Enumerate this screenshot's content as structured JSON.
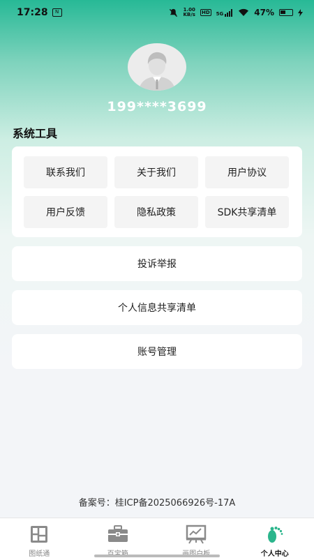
{
  "status_bar": {
    "time": "17:28",
    "app_badge": "N",
    "speed_value": "1.00",
    "speed_unit": "KB/s",
    "hd": "HD",
    "signal": "5G",
    "battery": "47%"
  },
  "profile": {
    "phone": "199****3699"
  },
  "tools": {
    "title": "系统工具",
    "items": [
      {
        "label": "联系我们"
      },
      {
        "label": "关于我们"
      },
      {
        "label": "用户协议"
      },
      {
        "label": "用户反馈"
      },
      {
        "label": "隐私政策"
      },
      {
        "label": "SDK共享清单"
      }
    ]
  },
  "rows": [
    {
      "label": "投诉举报"
    },
    {
      "label": "个人信息共享清单"
    },
    {
      "label": "账号管理"
    }
  ],
  "icp": "备案号：桂ICP备2025066926号-17A",
  "tabs": [
    {
      "label": "图纸通",
      "icon": "blueprint-icon"
    },
    {
      "label": "百宝箱",
      "icon": "toolbox-icon"
    },
    {
      "label": "画图白板",
      "icon": "whiteboard-icon"
    },
    {
      "label": "个人中心",
      "icon": "footprint-icon",
      "active": true
    }
  ],
  "colors": {
    "accent": "#27b996",
    "tab_active_icon": "#2bb58c",
    "tab_inactive_icon": "#8a8a8a"
  }
}
